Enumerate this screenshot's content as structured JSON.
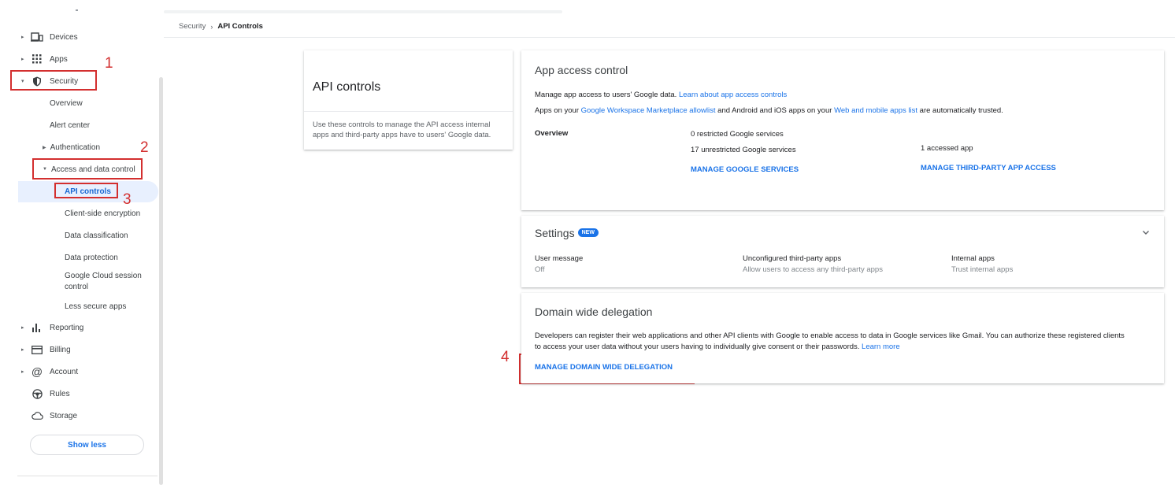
{
  "sidebar": {
    "items": [
      {
        "label": "Devices",
        "icon": "devices-icon"
      },
      {
        "label": "Apps",
        "icon": "apps-grid-icon"
      },
      {
        "label": "Security",
        "icon": "shield-icon"
      },
      {
        "label": "Reporting",
        "icon": "bar-chart-icon"
      },
      {
        "label": "Billing",
        "icon": "credit-card-icon"
      },
      {
        "label": "Account",
        "icon": "at-sign-icon"
      },
      {
        "label": "Rules",
        "icon": "steering-wheel-icon"
      },
      {
        "label": "Storage",
        "icon": "cloud-icon"
      }
    ],
    "security_sub": {
      "overview": "Overview",
      "alert_center": "Alert center",
      "authentication": "Authentication",
      "access_data_control": "Access and data control",
      "api_controls": "API controls",
      "client_side_encryption": "Client-side encryption",
      "data_classification": "Data classification",
      "data_protection": "Data protection",
      "gcloud_session_line1": "Google Cloud session",
      "gcloud_session_line2": "control",
      "less_secure_apps": "Less secure apps"
    },
    "show_less": "Show less"
  },
  "annotations": [
    "1",
    "2",
    "3",
    "4"
  ],
  "breadcrumb": {
    "parent": "Security",
    "separator": "›",
    "current": "API Controls"
  },
  "left_card": {
    "title": "API controls",
    "description": "Use these controls to manage the API access internal apps and third-party apps have to users' Google data."
  },
  "app_access": {
    "title": "App access control",
    "line1_text": "Manage app access to users' Google data.",
    "line1_link": "Learn about app access controls",
    "line2_a": "Apps on your",
    "line2_link1": "Google Workspace Marketplace allowlist",
    "line2_b": "and Android and iOS apps on your",
    "line2_link2": "Web and mobile apps list",
    "line2_c": "are automatically trusted.",
    "overview_label": "Overview",
    "restricted": "0 restricted Google services",
    "unrestricted": "17 unrestricted Google services",
    "accessed": "1 accessed app",
    "manage_google": "MANAGE GOOGLE SERVICES",
    "manage_third_party": "MANAGE THIRD-PARTY APP ACCESS"
  },
  "settings": {
    "title": "Settings",
    "badge": "NEW",
    "user_message_label": "User message",
    "user_message_value": "Off",
    "unconfigured_label": "Unconfigured third-party apps",
    "unconfigured_value": "Allow users to access any third-party apps",
    "internal_label": "Internal apps",
    "internal_value": "Trust internal apps"
  },
  "delegation": {
    "title": "Domain wide delegation",
    "desc1": "Developers can register their web applications and other API clients with Google to enable access to data in Google services like Gmail. You can authorize these registered clients",
    "desc2": "to access your user data without your users having to individually give consent or their passwords.",
    "learn_more": "Learn more",
    "manage": "MANAGE DOMAIN WIDE DELEGATION"
  },
  "colors": {
    "accent": "#1a73e8",
    "annotation": "#d32f2f",
    "active_bg": "#e8f0fe"
  }
}
